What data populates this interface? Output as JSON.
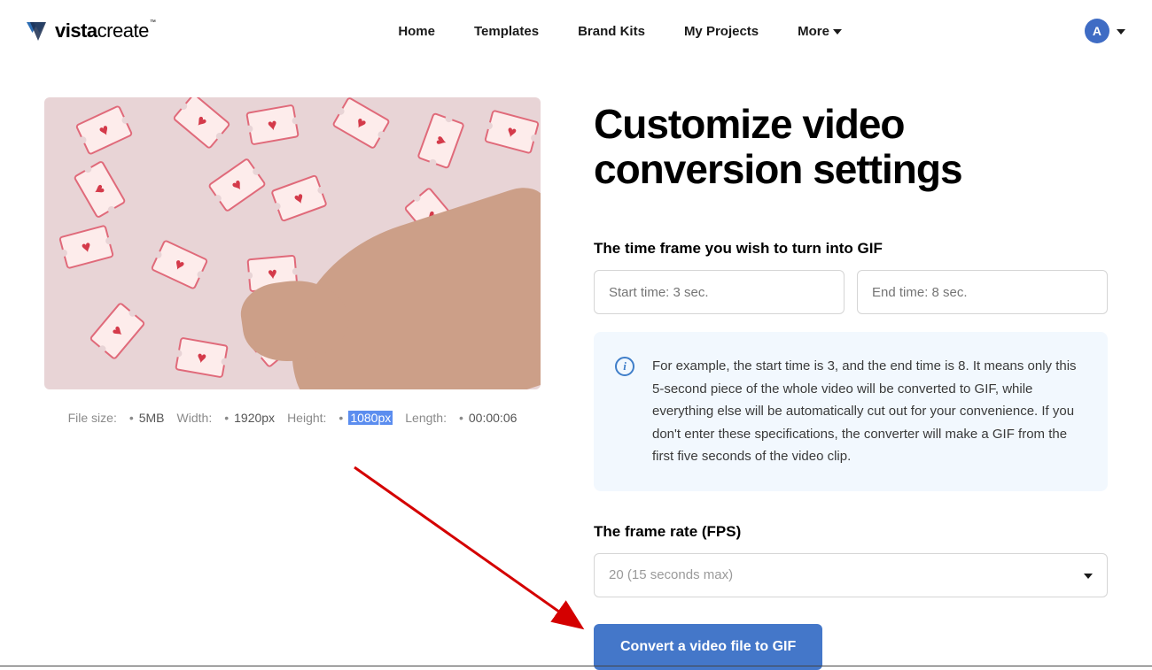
{
  "brand": {
    "name_bold": "vista",
    "name_light": "create",
    "tm": "™"
  },
  "nav": {
    "home": "Home",
    "templates": "Templates",
    "brandkits": "Brand Kits",
    "myprojects": "My Projects",
    "more": "More"
  },
  "user": {
    "initial": "A"
  },
  "meta": {
    "filesize_label": "File size:",
    "filesize_value": "5MB",
    "width_label": "Width:",
    "width_value": "1920px",
    "height_label": "Height:",
    "height_value": "1080px",
    "length_label": "Length:",
    "length_value": "00:00:06"
  },
  "form": {
    "title": "Customize video conversion settings",
    "time_label": "The time frame you wish to turn into GIF",
    "start_placeholder": "Start time: 3 sec.",
    "end_placeholder": "End time: 8 sec.",
    "info_text": "For example, the start time is 3, and the end time is 8. It means only this 5-second piece of the whole video will be converted to GIF, while everything else will be automatically cut out for your convenience. If you don't enter these specifications, the converter will make a GIF from the first five seconds of the video clip.",
    "fps_label": "The frame rate (FPS)",
    "fps_value": "20 (15 seconds max)",
    "convert_label": "Convert a video file to GIF"
  }
}
